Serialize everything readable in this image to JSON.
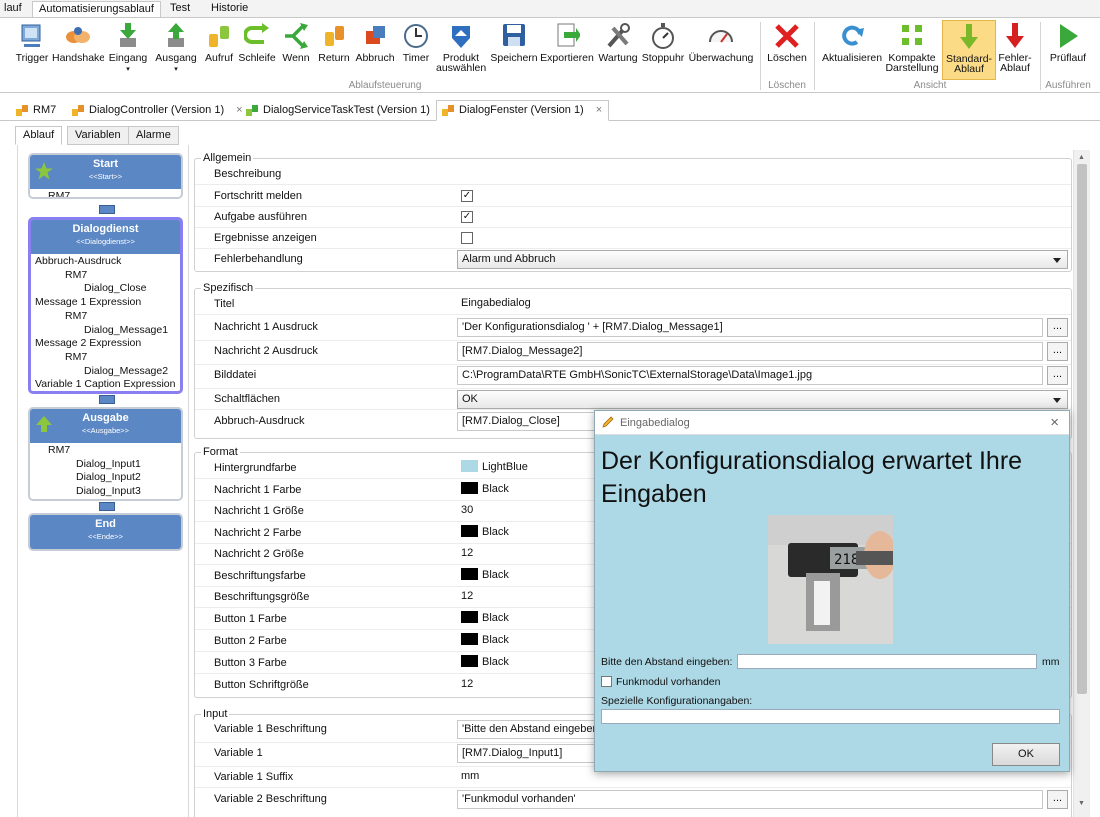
{
  "menubar": {
    "items": [
      "lauf",
      "Automatisierungsablauf",
      "Test",
      "Historie"
    ]
  },
  "ribbon": {
    "buttons": [
      {
        "label": "Trigger",
        "icon": "trigger-icon"
      },
      {
        "label": "Handshake",
        "icon": "handshake-icon"
      },
      {
        "label": "Eingang",
        "icon": "input-arrow-icon"
      },
      {
        "label": "Ausgang",
        "icon": "output-arrow-icon"
      },
      {
        "label": "Aufruf",
        "icon": "call-icon"
      },
      {
        "label": "Schleife",
        "icon": "loop-icon"
      },
      {
        "label": "Wenn",
        "icon": "if-branch-icon"
      },
      {
        "label": "Return",
        "icon": "return-icon"
      },
      {
        "label": "Abbruch",
        "icon": "abort-icon"
      },
      {
        "label": "Timer",
        "icon": "timer-icon"
      },
      {
        "label": "Produkt\nauswählen",
        "icon": "product-select-icon"
      },
      {
        "label": "Speichern",
        "icon": "save-icon"
      },
      {
        "label": "Exportieren",
        "icon": "export-icon"
      },
      {
        "label": "Wartung",
        "icon": "maintenance-icon"
      },
      {
        "label": "Stoppuhr",
        "icon": "stopwatch-icon"
      },
      {
        "label": "Überwachung",
        "icon": "monitoring-icon"
      },
      {
        "label": "Löschen",
        "icon": "delete-icon"
      },
      {
        "label": "Aktualisieren",
        "icon": "refresh-icon"
      },
      {
        "label": "Kompakte\nDarstellung",
        "icon": "compact-view-icon"
      },
      {
        "label": "Standard-\nAblauf",
        "icon": "standard-flow-icon"
      },
      {
        "label": "Fehler-\nAblauf",
        "icon": "error-flow-icon"
      },
      {
        "label": "Prüflauf",
        "icon": "test-run-icon"
      }
    ],
    "groups": [
      "Ablaufsteuerung",
      "Löschen",
      "Ansicht",
      "Ausführen"
    ]
  },
  "doctabs": [
    "RM7",
    "DialogController (Version 1)",
    "DialogServiceTaskTest (Version 1)",
    "DialogFenster (Version 1)"
  ],
  "subtabs": [
    "Ablauf",
    "Variablen",
    "Alarme"
  ],
  "flow": {
    "start": {
      "title": "Start",
      "sub": "<<Start>>",
      "items": [
        "RM7"
      ]
    },
    "dialog": {
      "title": "Dialogdienst",
      "sub": "<<Dialogdienst>>",
      "items": [
        "Abbruch-Ausdruck",
        "RM7",
        "Dialog_Close",
        "Message 1 Expression",
        "RM7",
        "Dialog_Message1",
        "Message 2 Expression",
        "RM7",
        "Dialog_Message2",
        "Variable 1 Caption Expression"
      ]
    },
    "output": {
      "title": "Ausgabe",
      "sub": "<<Ausgabe>>",
      "items": [
        "RM7",
        "Dialog_Input1",
        "Dialog_Input2",
        "Dialog_Input3"
      ]
    },
    "end": {
      "title": "End",
      "sub": "<<Ende>>"
    }
  },
  "props": {
    "allgemein": {
      "title": "Allgemein",
      "rows": [
        {
          "label": "Beschreibung",
          "value": ""
        },
        {
          "label": "Fortschritt melden",
          "checked": "✓"
        },
        {
          "label": "Aufgabe ausführen",
          "checked": "✓"
        },
        {
          "label": "Ergebnisse anzeigen",
          "checked": ""
        },
        {
          "label": "Fehlerbehandlung",
          "value": "Alarm und Abbruch"
        }
      ]
    },
    "spezifisch": {
      "title": "Spezifisch",
      "rows": [
        {
          "label": "Titel",
          "value": "Eingabedialog"
        },
        {
          "label": "Nachricht 1 Ausdruck",
          "value": "'Der Konfigurationsdialog ' + [RM7.Dialog_Message1]"
        },
        {
          "label": "Nachricht 2 Ausdruck",
          "value": "[RM7.Dialog_Message2]"
        },
        {
          "label": "Bilddatei",
          "value": "C:\\ProgramData\\RTE GmbH\\SonicTC\\ExternalStorage\\Data\\Image1.jpg"
        },
        {
          "label": "Schaltflächen",
          "value": "OK"
        },
        {
          "label": "Abbruch-Ausdruck",
          "value": "[RM7.Dialog_Close]"
        }
      ]
    },
    "format": {
      "title": "Format",
      "rows": [
        {
          "label": "Hintergrundfarbe",
          "value": "LightBlue",
          "color": "#add8e6"
        },
        {
          "label": "Nachricht 1 Farbe",
          "value": "Black",
          "color": "#000000"
        },
        {
          "label": "Nachricht 1 Größe",
          "value": "30"
        },
        {
          "label": "Nachricht 2 Farbe",
          "value": "Black",
          "color": "#000000"
        },
        {
          "label": "Nachricht 2 Größe",
          "value": "12"
        },
        {
          "label": "Beschriftungsfarbe",
          "value": "Black",
          "color": "#000000"
        },
        {
          "label": "Beschriftungsgröße",
          "value": "12"
        },
        {
          "label": "Button 1 Farbe",
          "value": "Black",
          "color": "#000000"
        },
        {
          "label": "Button 2 Farbe",
          "value": "Black",
          "color": "#000000"
        },
        {
          "label": "Button 3 Farbe",
          "value": "Black",
          "color": "#000000"
        },
        {
          "label": "Button Schriftgröße",
          "value": "12"
        }
      ]
    },
    "input": {
      "title": "Input",
      "rows": [
        {
          "label": "Variable 1 Beschriftung",
          "value": "'Bitte den Abstand eingeben:"
        },
        {
          "label": "Variable 1",
          "value": "[RM7.Dialog_Input1]"
        },
        {
          "label": "Variable 1 Suffix",
          "value": "mm"
        },
        {
          "label": "Variable 2 Beschriftung",
          "value": "'Funkmodul vorhanden'"
        }
      ]
    }
  },
  "dialog": {
    "title": "Eingabedialog",
    "heading": "Der Konfigurationsdialog erwartet Ihre Eingaben",
    "label1": "Bitte den Abstand eingeben:",
    "unit": "mm",
    "checkbox_label": "Funkmodul vorhanden",
    "label3": "Spezielle Konfigurationangaben:",
    "ok": "OK",
    "image_readout": "2187"
  }
}
